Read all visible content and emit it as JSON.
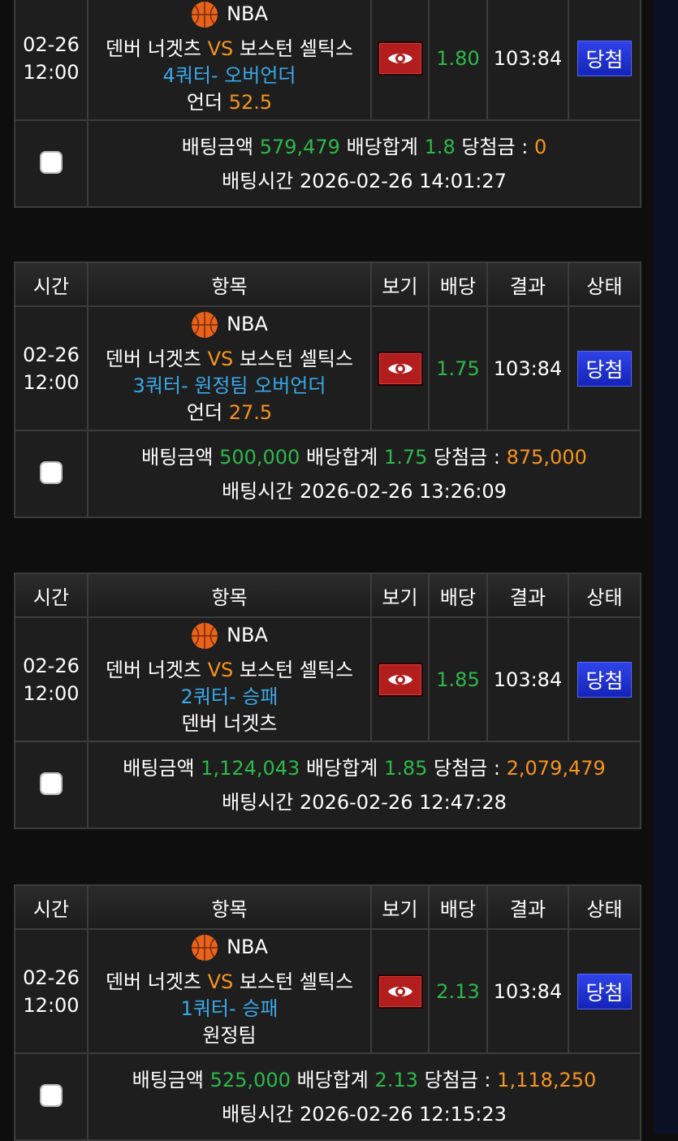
{
  "headers": {
    "time": "시간",
    "item": "항목",
    "view": "보기",
    "odds": "배당",
    "result": "결과",
    "status": "상태"
  },
  "labels": {
    "amount": "배팅금액",
    "odds_total": "배당합계",
    "win": "당첨금 :",
    "bet_time": "배팅시간",
    "vs": "VS"
  },
  "colors": {
    "odds": "#2db84b",
    "accent": "#f7941d",
    "market": "#3aa8e8",
    "status_bg": "#1e33d6",
    "eye_bg": "#b21e1e"
  },
  "bets": [
    {
      "date": "02-26",
      "time": "12:00",
      "league": "NBA",
      "home": "덴버 너겟츠",
      "away": "보스턴 셀틱스",
      "market": "4쿼터- 오버언더",
      "pick": "언더",
      "pick_value": "52.5",
      "odds": "1.80",
      "result": "103:84",
      "status": "당첨",
      "amount": "579,479",
      "odds_total": "1.8",
      "win_amount": "0",
      "bet_time": "2026-02-26 14:01:27"
    },
    {
      "date": "02-26",
      "time": "12:00",
      "league": "NBA",
      "home": "덴버 너겟츠",
      "away": "보스턴 셀틱스",
      "market": "3쿼터- 원정팀 오버언더",
      "pick": "언더",
      "pick_value": "27.5",
      "odds": "1.75",
      "result": "103:84",
      "status": "당첨",
      "amount": "500,000",
      "odds_total": "1.75",
      "win_amount": "875,000",
      "bet_time": "2026-02-26 13:26:09"
    },
    {
      "date": "02-26",
      "time": "12:00",
      "league": "NBA",
      "home": "덴버 너겟츠",
      "away": "보스턴 셀틱스",
      "market": "2쿼터- 승패",
      "pick": "덴버 너겟츠",
      "pick_value": "",
      "odds": "1.85",
      "result": "103:84",
      "status": "당첨",
      "amount": "1,124,043",
      "odds_total": "1.85",
      "win_amount": "2,079,479",
      "bet_time": "2026-02-26 12:47:28"
    },
    {
      "date": "02-26",
      "time": "12:00",
      "league": "NBA",
      "home": "덴버 너겟츠",
      "away": "보스턴 셀틱스",
      "market": "1쿼터- 승패",
      "pick": "원정팀",
      "pick_value": "",
      "odds": "2.13",
      "result": "103:84",
      "status": "당첨",
      "amount": "525,000",
      "odds_total": "2.13",
      "win_amount": "1,118,250",
      "bet_time": "2026-02-26 12:15:23"
    }
  ]
}
